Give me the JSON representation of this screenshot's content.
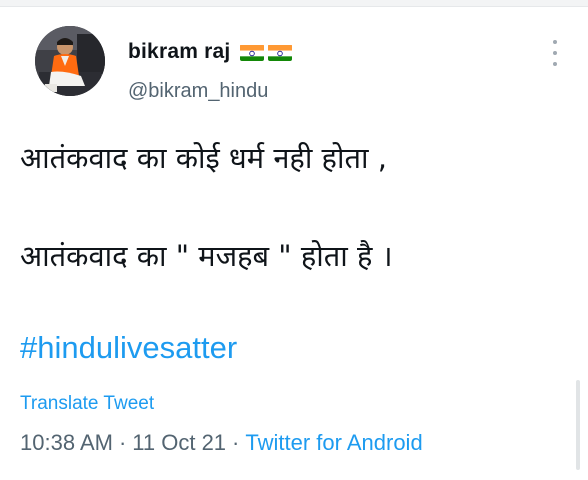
{
  "author": {
    "name": "bikram raj",
    "handle": "@bikram_hindu",
    "flag_count": 2
  },
  "tweet": {
    "lines": [
      "आतंकवाद का कोई धर्म नही होता ,",
      "आतंकवाद का \" मजहब \" होता है ।"
    ],
    "hashtag": "#hindulivesatter"
  },
  "translate_label": "Translate Tweet",
  "meta": {
    "time": "10:38 AM",
    "date": "11 Oct 21",
    "source": "Twitter for Android",
    "separator": "·"
  },
  "colors": {
    "link": "#1d9bf0",
    "secondary_text": "#536471",
    "primary_text": "#0f1419"
  },
  "icons": [
    "more-options-icon",
    "india-flag-icon"
  ]
}
